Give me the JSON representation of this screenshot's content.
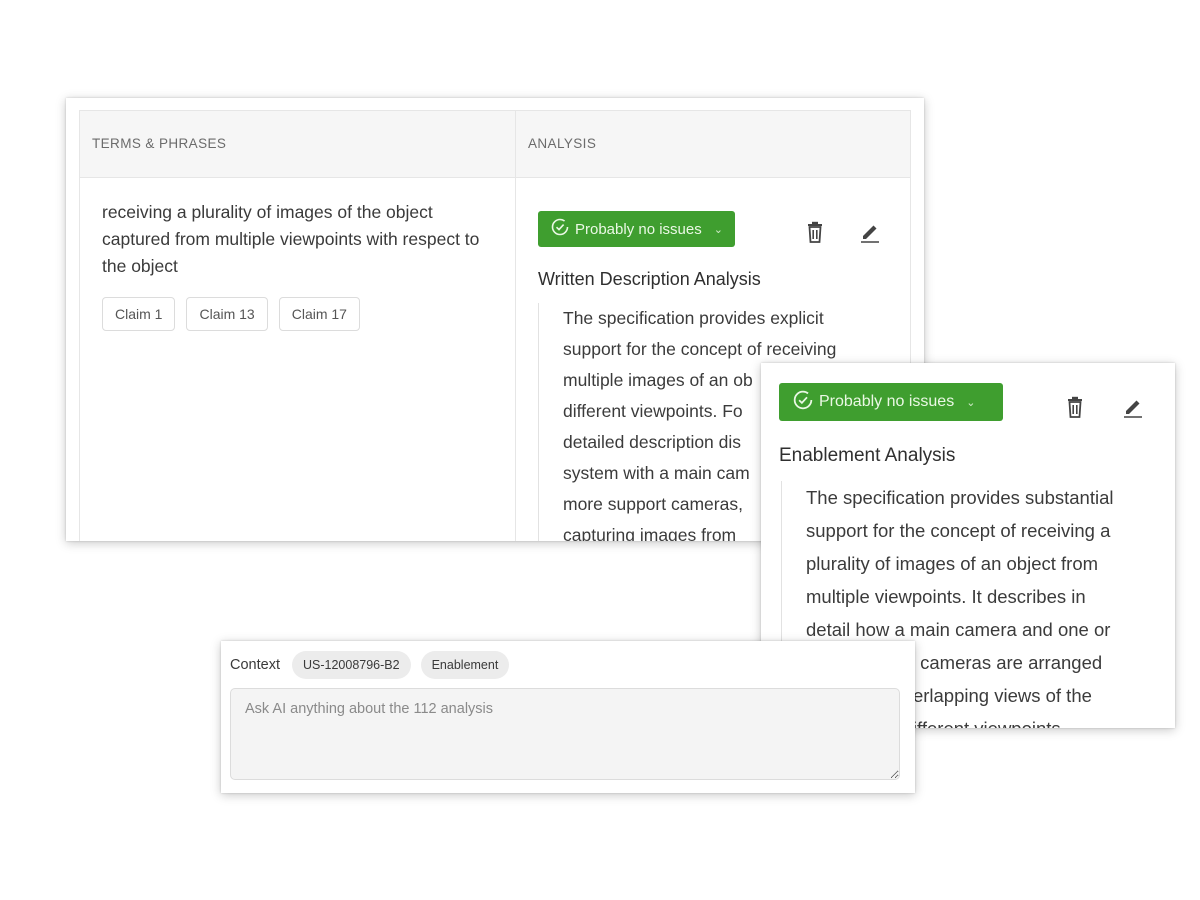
{
  "table": {
    "headers": {
      "terms": "TERMS & PHRASES",
      "analysis": "ANALYSIS"
    },
    "row": {
      "term": "receiving a plurality of images of the object captured from multiple viewpoints with respect to the object",
      "claims": [
        "Claim 1",
        "Claim 13",
        "Claim 17"
      ]
    }
  },
  "written_description": {
    "status": "Probably no issues",
    "status_color": "#3f9e2f",
    "title": "Written Description Analysis",
    "lines": [
      "The specification provides explicit",
      "support for the concept of receiving",
      "multiple images of an ob",
      "different viewpoints. Fo",
      "detailed description dis",
      "system with a main cam",
      "more support cameras,",
      "capturing images from"
    ],
    "icons": [
      "trash-icon",
      "edit-pencil-icon",
      "check-circle-icon",
      "chevron-down-icon"
    ]
  },
  "enablement": {
    "status": "Probably no issues",
    "status_color": "#3f9e2f",
    "title": "Enablement Analysis",
    "lines": [
      "The specification provides substantial",
      "support for the concept of receiving a",
      "plurality of images of an object from",
      "multiple viewpoints. It describes in",
      "detail how a main camera and one or",
      "more support cameras are arranged",
      "to capture overlapping views of the",
      "object from different viewpoints"
    ]
  },
  "ask": {
    "context_label": "Context",
    "chips": [
      "US-12008796-B2",
      "Enablement"
    ],
    "placeholder": "Ask AI anything about the 112 analysis",
    "value": ""
  }
}
